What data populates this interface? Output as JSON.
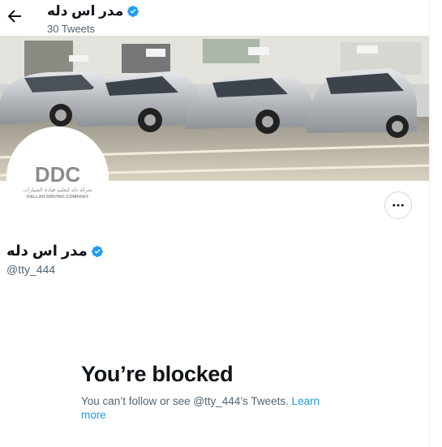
{
  "header": {
    "name": "مدر اس دله",
    "tweet_count": "30 Tweets"
  },
  "profile": {
    "name": "مدر اس دله",
    "handle": "@tty_444",
    "avatar": {
      "logo_text": "DDC",
      "arabic_text": "شركة دله لتعليم قيادة السيارات",
      "english_text": "DALLAH DRIVING COMPANY"
    }
  },
  "blocked": {
    "title": "You’re blocked",
    "message": "You can’t follow or see @tty_444’s Tweets.",
    "link": "Learn more"
  },
  "colors": {
    "accent": "#1d9bf0",
    "secondary_text": "#536471"
  },
  "icons": [
    "back-arrow-icon",
    "verified-badge-icon",
    "more-icon"
  ]
}
